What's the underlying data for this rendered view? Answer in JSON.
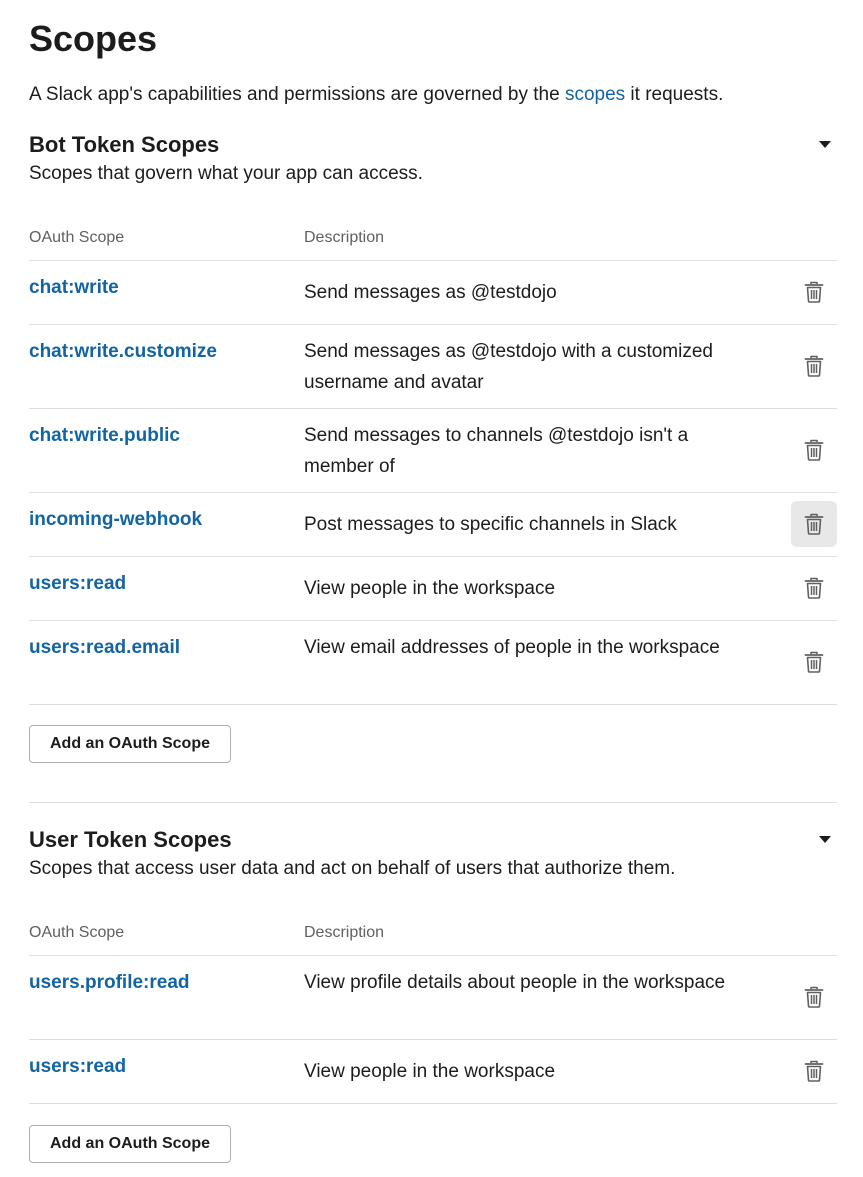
{
  "page": {
    "title": "Scopes",
    "intro_before": "A Slack app's capabilities and permissions are governed by the ",
    "intro_link": "scopes",
    "intro_after": " it requests."
  },
  "bot_scopes": {
    "title": "Bot Token Scopes",
    "subtitle": "Scopes that govern what your app can access.",
    "col_scope": "OAuth Scope",
    "col_description": "Description",
    "rows": [
      {
        "scope": "chat:write",
        "description": "Send messages as @testdojo"
      },
      {
        "scope": "chat:write.customize",
        "description": "Send messages as @testdojo with a customized username and avatar"
      },
      {
        "scope": "chat:write.public",
        "description": "Send messages to channels @testdojo isn't a member of"
      },
      {
        "scope": "incoming-webhook",
        "description": "Post messages to specific channels in Slack"
      },
      {
        "scope": "users:read",
        "description": "View people in the workspace"
      },
      {
        "scope": "users:read.email",
        "description": "View email addresses of people in the workspace"
      }
    ],
    "add_button": "Add an OAuth Scope"
  },
  "user_scopes": {
    "title": "User Token Scopes",
    "subtitle": "Scopes that access user data and act on behalf of users that authorize them.",
    "col_scope": "OAuth Scope",
    "col_description": "Description",
    "rows": [
      {
        "scope": "users.profile:read",
        "description": "View profile details about people in the workspace"
      },
      {
        "scope": "users:read",
        "description": "View people in the workspace"
      }
    ],
    "add_button": "Add an OAuth Scope"
  },
  "icons": {
    "delete": "trash-icon",
    "collapse": "caret-down-icon"
  },
  "colors": {
    "link": "#1264a3",
    "text": "#1d1c1d",
    "muted": "#616061",
    "border": "#dddddd",
    "hover": "#e8e8e8"
  }
}
